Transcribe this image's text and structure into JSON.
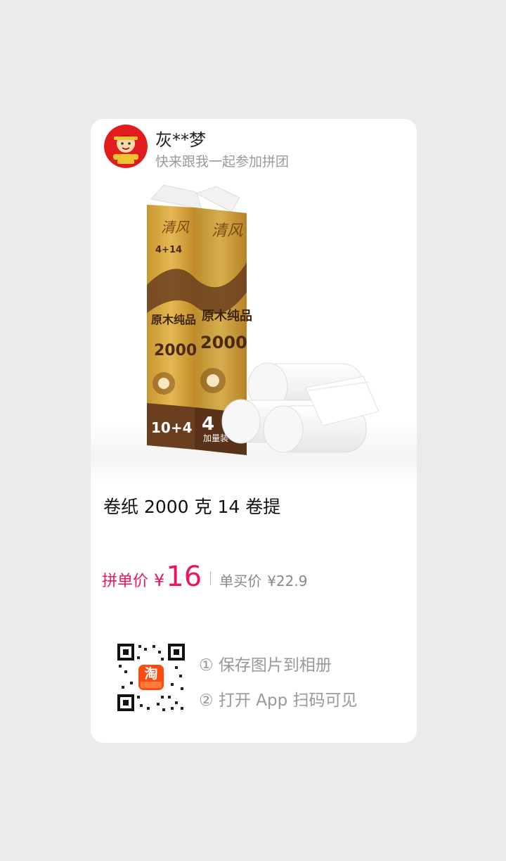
{
  "user": {
    "name": "灰**梦",
    "invite_text": "快来跟我一起参加拼团"
  },
  "product": {
    "title": "卷纸 2000 克 14 卷提",
    "image_texts": {
      "brand": "清风",
      "tagline": "原木纯品",
      "grams": "2000",
      "count": "10+4",
      "bonus": "4",
      "bonus_note": "加量装",
      "side_badge": "4+14"
    }
  },
  "price": {
    "group_label": "拼单价",
    "currency": "¥",
    "group_price": "16",
    "single_label": "单买价",
    "single_price": "¥22.9"
  },
  "share": {
    "step1": "① 保存图片到相册",
    "step2": "② 打开 App 扫码可见",
    "app_badge": "淘"
  },
  "colors": {
    "accent": "#e8175d",
    "page_bg": "#ebebeb",
    "muted": "#999999",
    "package_gold": "#d4a33a",
    "package_brown": "#6b3e1f"
  }
}
